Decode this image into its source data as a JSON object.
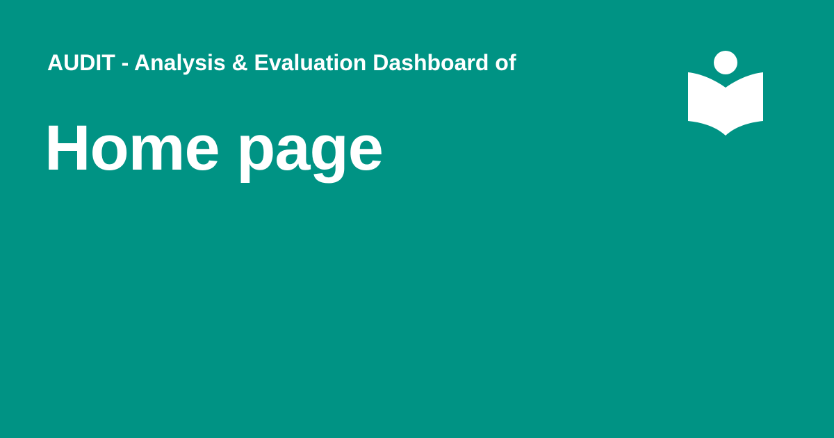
{
  "header": {
    "subtitle": "AUDIT - Analysis & Evaluation Dashboard of",
    "title": "Home page"
  },
  "logo": {
    "icon": "reader-book-icon"
  },
  "colors": {
    "background": "#009384",
    "text": "#ffffff"
  }
}
